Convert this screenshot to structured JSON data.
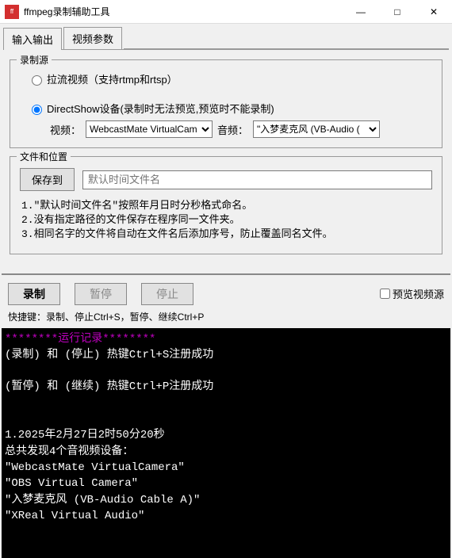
{
  "window": {
    "title": "ffmpeg录制辅助工具",
    "minimize": "—",
    "maximize": "□",
    "close": "✕"
  },
  "tabs": {
    "io": "输入输出",
    "video": "视频参数"
  },
  "source": {
    "legend": "录制源",
    "pull": "拉流视频（支持rtmp和rtsp）",
    "dshow": "DirectShow设备(录制时无法预览,预览时不能录制)",
    "video_label": "视频：",
    "video_value": "WebcastMate VirtualCam",
    "audio_label": "音频：",
    "audio_value": "\"入梦麦克风 (VB-Audio ("
  },
  "file": {
    "legend": "文件和位置",
    "save_to": "保存到",
    "filename_placeholder": "默认时间文件名",
    "note1": "1.\"默认时间文件名\"按照年月日时分秒格式命名。",
    "note2": "2.没有指定路径的文件保存在程序同一文件夹。",
    "note3": "3.相同名字的文件将自动在文件名后添加序号，防止覆盖同名文件。"
  },
  "control": {
    "record": "录制",
    "pause": "暂停",
    "stop": "停止",
    "preview": "预览视频源",
    "hotkeys": "快捷键：录制、停止Ctrl+S，暂停、继续Ctrl+P"
  },
  "console": {
    "header": "********运行记录********",
    "line1": "(录制) 和 (停止) 热键Ctrl+S注册成功",
    "line2": "(暂停) 和 (继续) 热键Ctrl+P注册成功",
    "ts": "1.2025年2月27日2时50分20秒",
    "found": "总共发现4个音视频设备：",
    "d1": "\"WebcastMate VirtualCamera\"",
    "d2": "\"OBS Virtual Camera\"",
    "d3": "\"入梦麦克风 (VB-Audio Cable A)\"",
    "d4": "\"XReal Virtual Audio\""
  }
}
